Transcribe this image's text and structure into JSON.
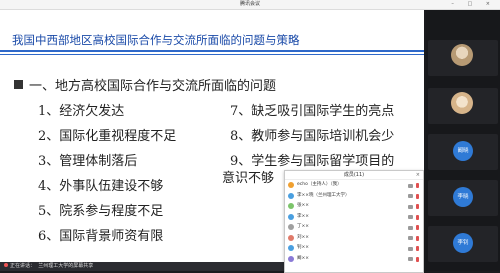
{
  "window": {
    "title": "腾讯会议",
    "controls": "– □ ×"
  },
  "slide": {
    "title": "我国中西部地区高校国际合作与交流所面临的问题与策略",
    "heading": "一、地方高校国际合作与交流所面临的问题",
    "items_left": [
      "1、经济欠发达",
      "2、国际化重视程度不足",
      "3、管理体制落后",
      "4、外事队伍建设不够",
      "5、院系参与程度不足",
      "6、国际背景师资有限"
    ],
    "items_right": [
      "7、缺乏吸引国际学生的亮点",
      "8、教师参与国际培训机会少",
      "9、学生参与国际留学项目的",
      "意识不够"
    ]
  },
  "bottom_bar": {
    "speaker": "正在讲话：",
    "source": "兰州理工大学的屏幕共享"
  },
  "tiles": [
    {
      "name": "",
      "type": "photo",
      "color": "#b79a74"
    },
    {
      "name": "",
      "type": "photo",
      "color": "#d6b48a"
    },
    {
      "name": "",
      "initials": "阚晓",
      "color": "#2f7ad6"
    },
    {
      "name": "",
      "initials": "李晓",
      "color": "#2f7ad6"
    },
    {
      "name": "",
      "initials": "李钊",
      "color": "#2f7ad6"
    }
  ],
  "panel": {
    "title": "成员(11)",
    "close": "×",
    "members": [
      {
        "name": "echo（主持人）（我）",
        "color": "#f0a030"
      },
      {
        "name": "李××晓（兰州理工大学）",
        "color": "#4a9fe0"
      },
      {
        "name": "张××",
        "color": "#7cc46a"
      },
      {
        "name": "李××",
        "color": "#4a9fe0"
      },
      {
        "name": "丁××",
        "color": "#a0a0a0"
      },
      {
        "name": "刘××",
        "color": "#e07a6a"
      },
      {
        "name": "钊××",
        "color": "#4a9fe0"
      },
      {
        "name": "阚××",
        "color": "#8a7ad6"
      }
    ]
  }
}
